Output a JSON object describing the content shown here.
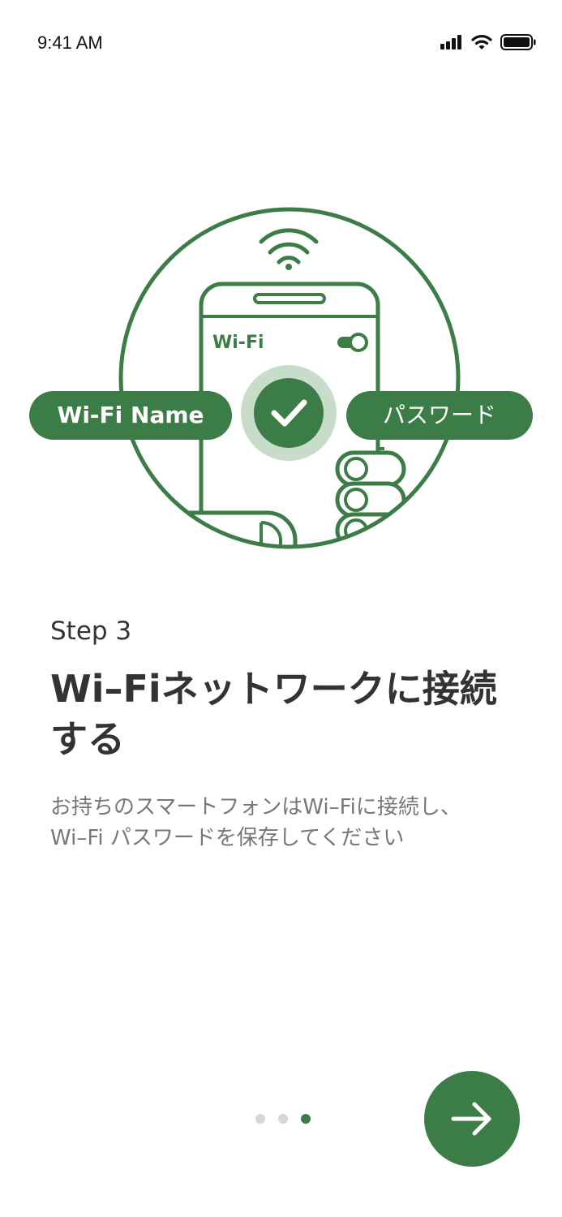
{
  "status_bar": {
    "time": "9:41 AM",
    "icons": [
      "signal-icon",
      "wifi-icon",
      "battery-icon"
    ]
  },
  "illustration": {
    "wifi_label": "Wi-Fi",
    "name_pill": "Wi-Fi Name",
    "password_pill": "パスワード",
    "icons": [
      "wifi-signal-icon",
      "smartphone-icon",
      "toggle-icon",
      "check-icon",
      "hand-icon"
    ]
  },
  "content": {
    "step": "Step 3",
    "title": "Wi–Fiネットワークに接続する",
    "description_line1": "お持ちのスマートフォンはWi–Fiに接続し、",
    "description_line2": "Wi–Fi パスワードを保存してください"
  },
  "pager": {
    "total": 3,
    "current": 3
  },
  "next_button": {
    "icon": "arrow-right-icon"
  },
  "colors": {
    "accent": "#3c7d47",
    "accent_light": "#c7dcc9",
    "title_text": "#333333",
    "body_text": "#777777",
    "inactive_dot": "#d6d6d6"
  }
}
